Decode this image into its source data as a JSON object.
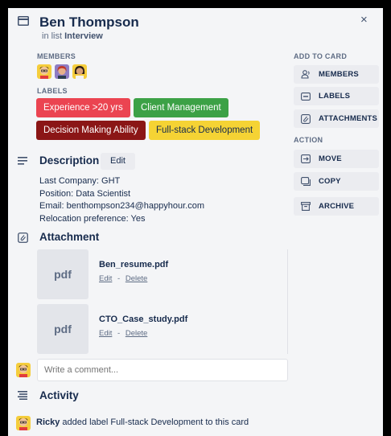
{
  "card": {
    "title": "Ben Thompson",
    "list_prefix": "in list",
    "list_name": "Interview",
    "close_glyph": "×"
  },
  "members": {
    "heading": "MEMBERS",
    "avatars": [
      "avatar-yellow-man",
      "avatar-purple-woman",
      "avatar-yellow-woman"
    ]
  },
  "labels": {
    "heading": "LABELS",
    "items": [
      {
        "text": "Experience >20 yrs",
        "bg": "#eb4451",
        "fg": "#ffffff"
      },
      {
        "text": "Client Management",
        "bg": "#3ca146",
        "fg": "#ffffff"
      },
      {
        "text": "Decision Making Ability",
        "bg": "#8b1616",
        "fg": "#ffffff"
      },
      {
        "text": "Full-stack Development",
        "bg": "#f5d334",
        "fg": "#172b4d"
      }
    ]
  },
  "description": {
    "heading": "Description",
    "edit_label": "Edit",
    "lines": [
      "Last Company: GHT",
      "Position: Data Scientist",
      "Email: benthompson234@happyhour.com",
      "Relocation preference: Yes"
    ]
  },
  "attachments": {
    "heading": "Attachment",
    "items": [
      {
        "thumb": "pdf",
        "name": "Ben_resume.pdf",
        "edit": "Edit",
        "sep": "-",
        "delete": "Delete"
      },
      {
        "thumb": "pdf",
        "name": "CTO_Case_study.pdf",
        "edit": "Edit",
        "sep": "-",
        "delete": "Delete"
      }
    ]
  },
  "comment": {
    "placeholder": "Write a comment..."
  },
  "activity": {
    "heading": "Activity",
    "entries": [
      {
        "user": "Ricky",
        "text": "added label Full-stack Development to this card"
      }
    ]
  },
  "sidebar": {
    "add_heading": "ADD TO CARD",
    "add_items": [
      {
        "label": "MEMBERS",
        "icon": "person-icon"
      },
      {
        "label": "LABELS",
        "icon": "label-icon"
      },
      {
        "label": "ATTACHMENTS",
        "icon": "paperclip-icon"
      }
    ],
    "action_heading": "ACTION",
    "action_items": [
      {
        "label": "MOVE",
        "icon": "move-icon"
      },
      {
        "label": "COPY",
        "icon": "copy-icon"
      },
      {
        "label": "ARCHIVE",
        "icon": "archive-icon"
      }
    ]
  },
  "colors": {
    "panel_bg": "#f4f5f7",
    "button_bg": "#ebecf0",
    "text": "#172b4d",
    "muted": "#5e6c84"
  }
}
